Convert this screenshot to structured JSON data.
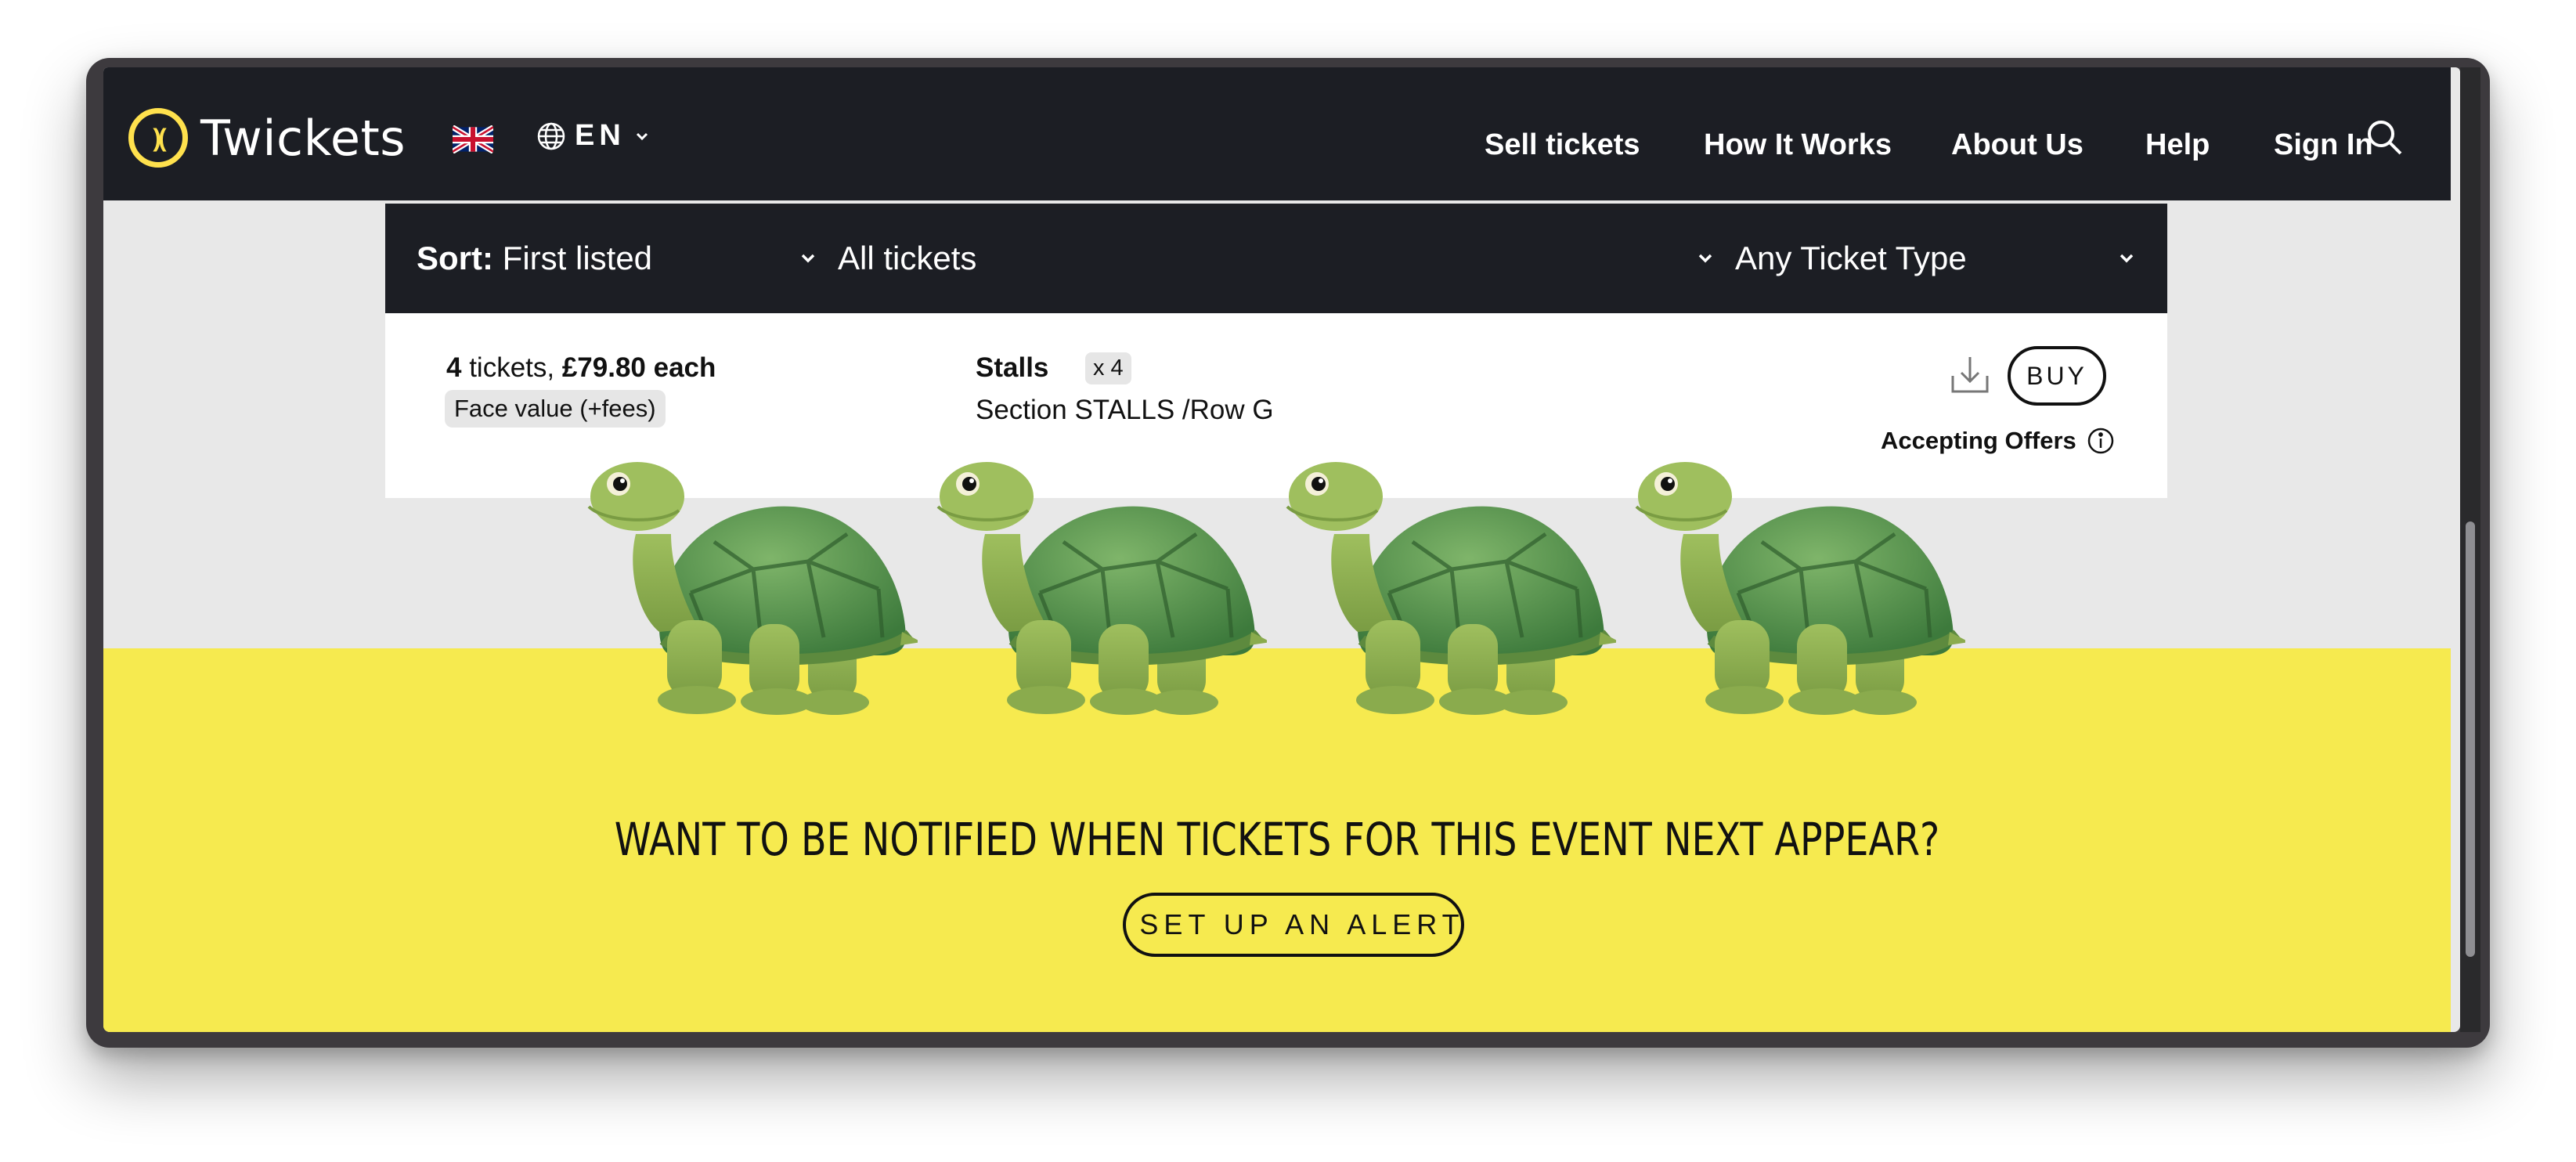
{
  "header": {
    "brand": "Twickets",
    "language": "EN",
    "nav": [
      "Sell tickets",
      "How It Works",
      "About Us",
      "Help",
      "Sign In"
    ],
    "icons": {
      "flag": "uk-flag-icon",
      "language": "globe-icon",
      "search": "search-icon"
    }
  },
  "filters": {
    "sort_label": "Sort:",
    "sort_value": "First listed",
    "quantity": "All tickets",
    "ticket_type": "Any Ticket Type"
  },
  "listing": {
    "qty_number": "4",
    "qty_word": " tickets, ",
    "price": "£79.80 each",
    "face_value": "Face value (+fees)",
    "area": "Stalls",
    "area_count": "x 4",
    "seat_info": "Section STALLS /Row G",
    "buy_label": "BUY",
    "offers_label": "Accepting Offers",
    "icons": {
      "download": "download-icon",
      "info": "info-icon"
    }
  },
  "alert": {
    "title": "WANT TO BE NOTIFIED WHEN TICKETS FOR THIS EVENT NEXT APPEAR?",
    "button": "SET UP AN ALERT",
    "icon": "bell-icon"
  },
  "colors": {
    "navbar": "#1c1e24",
    "brand_yellow": "#ffe14d",
    "band_yellow": "#f6ea4f",
    "page_grey": "#e8e8e8"
  }
}
